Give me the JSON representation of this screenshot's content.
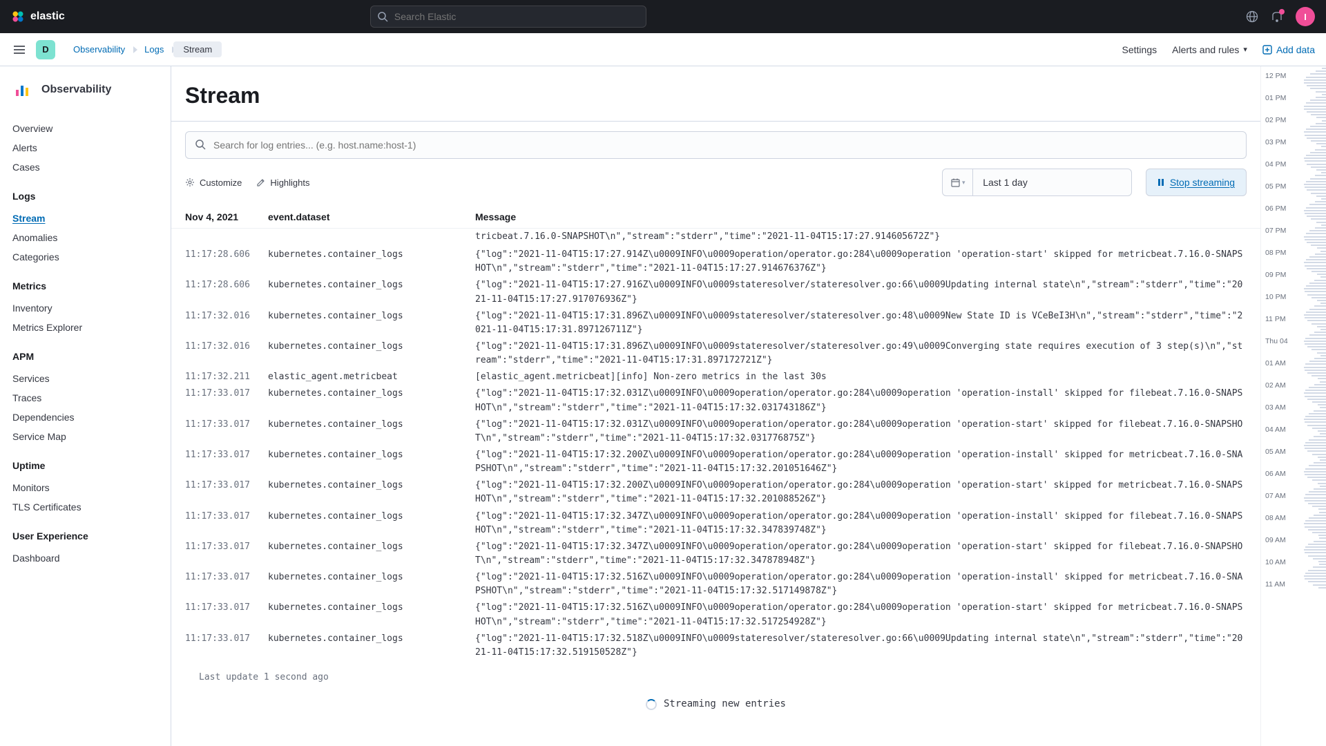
{
  "brand": {
    "name": "elastic",
    "avatar_initial": "I"
  },
  "global_search": {
    "placeholder": "Search Elastic"
  },
  "space": {
    "initial": "D"
  },
  "breadcrumbs": [
    {
      "label": "Observability",
      "active": false
    },
    {
      "label": "Logs",
      "active": false
    },
    {
      "label": "Stream",
      "active": true
    }
  ],
  "sub_header": {
    "settings": "Settings",
    "alerts": "Alerts and rules",
    "add_data": "Add data"
  },
  "sidebar": {
    "title": "Observability",
    "groups": [
      {
        "label": null,
        "items": [
          {
            "label": "Overview",
            "active": false
          },
          {
            "label": "Alerts",
            "active": false
          },
          {
            "label": "Cases",
            "active": false
          }
        ]
      },
      {
        "label": "Logs",
        "items": [
          {
            "label": "Stream",
            "active": true
          },
          {
            "label": "Anomalies",
            "active": false
          },
          {
            "label": "Categories",
            "active": false
          }
        ]
      },
      {
        "label": "Metrics",
        "items": [
          {
            "label": "Inventory",
            "active": false
          },
          {
            "label": "Metrics Explorer",
            "active": false
          }
        ]
      },
      {
        "label": "APM",
        "items": [
          {
            "label": "Services",
            "active": false
          },
          {
            "label": "Traces",
            "active": false
          },
          {
            "label": "Dependencies",
            "active": false
          },
          {
            "label": "Service Map",
            "active": false
          }
        ]
      },
      {
        "label": "Uptime",
        "items": [
          {
            "label": "Monitors",
            "active": false
          },
          {
            "label": "TLS Certificates",
            "active": false
          }
        ]
      },
      {
        "label": "User Experience",
        "items": [
          {
            "label": "Dashboard",
            "active": false
          }
        ]
      }
    ]
  },
  "page": {
    "title": "Stream",
    "search_placeholder": "Search for log entries... (e.g. host.name:host-1)",
    "customize": "Customize",
    "highlights": "Highlights",
    "date_range": "Last 1 day",
    "stream_button": "Stop streaming",
    "last_update": "Last update 1 second ago",
    "streaming_text": "Streaming new entries"
  },
  "columns": {
    "date": "Nov 4, 2021",
    "dataset": "event.dataset",
    "message": "Message"
  },
  "partial_first_line": "tricbeat.7.16.0-SNAPSHOT\\n\",\"stream\":\"stderr\",\"time\":\"2021-11-04T15:17:27.914605672Z\"}",
  "logs": [
    {
      "t": "11:17:28.606",
      "d": "kubernetes.container_logs",
      "m": "{\"log\":\"2021-11-04T15:17:27.914Z\\u0009INFO\\u0009operation/operator.go:284\\u0009operation 'operation-start' skipped for metricbeat.7.16.0-SNAPSHOT\\n\",\"stream\":\"stderr\",\"time\":\"2021-11-04T15:17:27.914676376Z\"}"
    },
    {
      "t": "11:17:28.606",
      "d": "kubernetes.container_logs",
      "m": "{\"log\":\"2021-11-04T15:17:27.916Z\\u0009INFO\\u0009stateresolver/stateresolver.go:66\\u0009Updating internal state\\n\",\"stream\":\"stderr\",\"time\":\"2021-11-04T15:17:27.917076936Z\"}"
    },
    {
      "t": "11:17:32.016",
      "d": "kubernetes.container_logs",
      "m": "{\"log\":\"2021-11-04T15:17:31.896Z\\u0009INFO\\u0009stateresolver/stateresolver.go:48\\u0009New State ID is VCeBeI3H\\n\",\"stream\":\"stderr\",\"time\":\"2021-11-04T15:17:31.897126711Z\"}"
    },
    {
      "t": "11:17:32.016",
      "d": "kubernetes.container_logs",
      "m": "{\"log\":\"2021-11-04T15:17:31.896Z\\u0009INFO\\u0009stateresolver/stateresolver.go:49\\u0009Converging state requires execution of 3 step(s)\\n\",\"stream\":\"stderr\",\"time\":\"2021-11-04T15:17:31.897172721Z\"}"
    },
    {
      "t": "11:17:32.211",
      "d": "elastic_agent.metricbeat",
      "m": "[elastic_agent.metricbeat][info] Non-zero metrics in the last 30s"
    },
    {
      "t": "11:17:33.017",
      "d": "kubernetes.container_logs",
      "m": "{\"log\":\"2021-11-04T15:17:32.031Z\\u0009INFO\\u0009operation/operator.go:284\\u0009operation 'operation-install' skipped for filebeat.7.16.0-SNAPSHOT\\n\",\"stream\":\"stderr\",\"time\":\"2021-11-04T15:17:32.031743186Z\"}"
    },
    {
      "t": "11:17:33.017",
      "d": "kubernetes.container_logs",
      "m": "{\"log\":\"2021-11-04T15:17:32.031Z\\u0009INFO\\u0009operation/operator.go:284\\u0009operation 'operation-start' skipped for filebeat.7.16.0-SNAPSHOT\\n\",\"stream\":\"stderr\",\"time\":\"2021-11-04T15:17:32.031776875Z\"}"
    },
    {
      "t": "11:17:33.017",
      "d": "kubernetes.container_logs",
      "m": "{\"log\":\"2021-11-04T15:17:32.200Z\\u0009INFO\\u0009operation/operator.go:284\\u0009operation 'operation-install' skipped for metricbeat.7.16.0-SNAPSHOT\\n\",\"stream\":\"stderr\",\"time\":\"2021-11-04T15:17:32.201051646Z\"}"
    },
    {
      "t": "11:17:33.017",
      "d": "kubernetes.container_logs",
      "m": "{\"log\":\"2021-11-04T15:17:32.200Z\\u0009INFO\\u0009operation/operator.go:284\\u0009operation 'operation-start' skipped for metricbeat.7.16.0-SNAPSHOT\\n\",\"stream\":\"stderr\",\"time\":\"2021-11-04T15:17:32.201088526Z\"}"
    },
    {
      "t": "11:17:33.017",
      "d": "kubernetes.container_logs",
      "m": "{\"log\":\"2021-11-04T15:17:32.347Z\\u0009INFO\\u0009operation/operator.go:284\\u0009operation 'operation-install' skipped for filebeat.7.16.0-SNAPSHOT\\n\",\"stream\":\"stderr\",\"time\":\"2021-11-04T15:17:32.347839748Z\"}"
    },
    {
      "t": "11:17:33.017",
      "d": "kubernetes.container_logs",
      "m": "{\"log\":\"2021-11-04T15:17:32.347Z\\u0009INFO\\u0009operation/operator.go:284\\u0009operation 'operation-start' skipped for filebeat.7.16.0-SNAPSHOT\\n\",\"stream\":\"stderr\",\"time\":\"2021-11-04T15:17:32.347878948Z\"}"
    },
    {
      "t": "11:17:33.017",
      "d": "kubernetes.container_logs",
      "m": "{\"log\":\"2021-11-04T15:17:32.516Z\\u0009INFO\\u0009operation/operator.go:284\\u0009operation 'operation-install' skipped for metricbeat.7.16.0-SNAPSHOT\\n\",\"stream\":\"stderr\",\"time\":\"2021-11-04T15:17:32.517149878Z\"}"
    },
    {
      "t": "11:17:33.017",
      "d": "kubernetes.container_logs",
      "m": "{\"log\":\"2021-11-04T15:17:32.516Z\\u0009INFO\\u0009operation/operator.go:284\\u0009operation 'operation-start' skipped for metricbeat.7.16.0-SNAPSHOT\\n\",\"stream\":\"stderr\",\"time\":\"2021-11-04T15:17:32.517254928Z\"}"
    },
    {
      "t": "11:17:33.017",
      "d": "kubernetes.container_logs",
      "m": "{\"log\":\"2021-11-04T15:17:32.518Z\\u0009INFO\\u0009stateresolver/stateresolver.go:66\\u0009Updating internal state\\n\",\"stream\":\"stderr\",\"time\":\"2021-11-04T15:17:32.519150528Z\"}"
    }
  ],
  "minimap": [
    "12 PM",
    "01 PM",
    "02 PM",
    "03 PM",
    "04 PM",
    "05 PM",
    "06 PM",
    "07 PM",
    "08 PM",
    "09 PM",
    "10 PM",
    "11 PM",
    "Thu 04",
    "01 AM",
    "02 AM",
    "03 AM",
    "04 AM",
    "05 AM",
    "06 AM",
    "07 AM",
    "08 AM",
    "09 AM",
    "10 AM",
    "11 AM"
  ]
}
